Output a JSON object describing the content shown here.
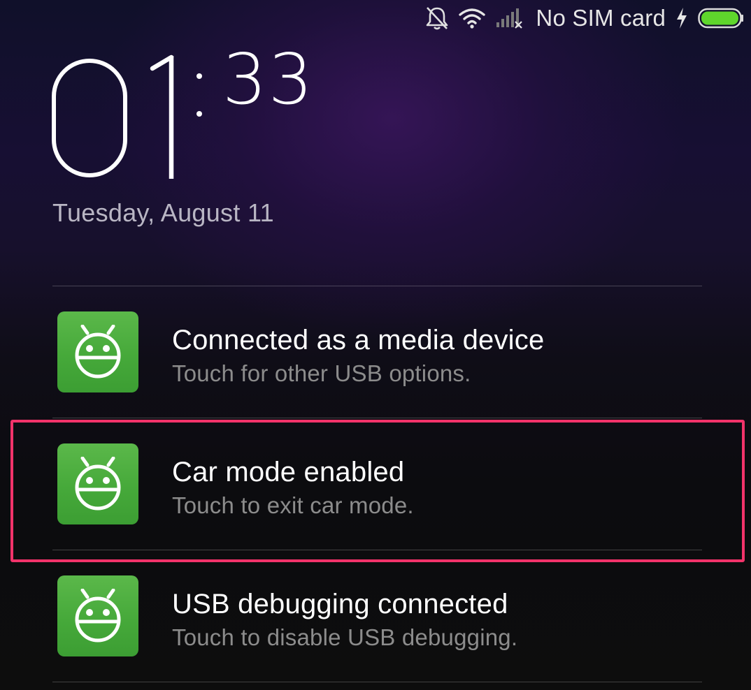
{
  "status_bar": {
    "carrier": "No SIM card",
    "icons": [
      "notifications-muted-icon",
      "wifi-icon",
      "no-signal-icon",
      "charging-bolt-icon",
      "battery-icon"
    ],
    "battery_color": "#5fd62c"
  },
  "lock_screen": {
    "hour": "01",
    "minutes": "33",
    "date": "Tuesday, August 11"
  },
  "notifications": [
    {
      "title": "Connected as a media device",
      "subtitle": "Touch for other USB options.",
      "icon": "android-icon"
    },
    {
      "title": "Car mode enabled",
      "subtitle": "Touch to exit car mode.",
      "icon": "android-icon",
      "highlighted": true
    },
    {
      "title": "USB debugging connected",
      "subtitle": "Touch to disable USB debugging.",
      "icon": "android-icon"
    }
  ],
  "colors": {
    "highlight": "#f2336a",
    "app_icon": "#4cae3d"
  }
}
